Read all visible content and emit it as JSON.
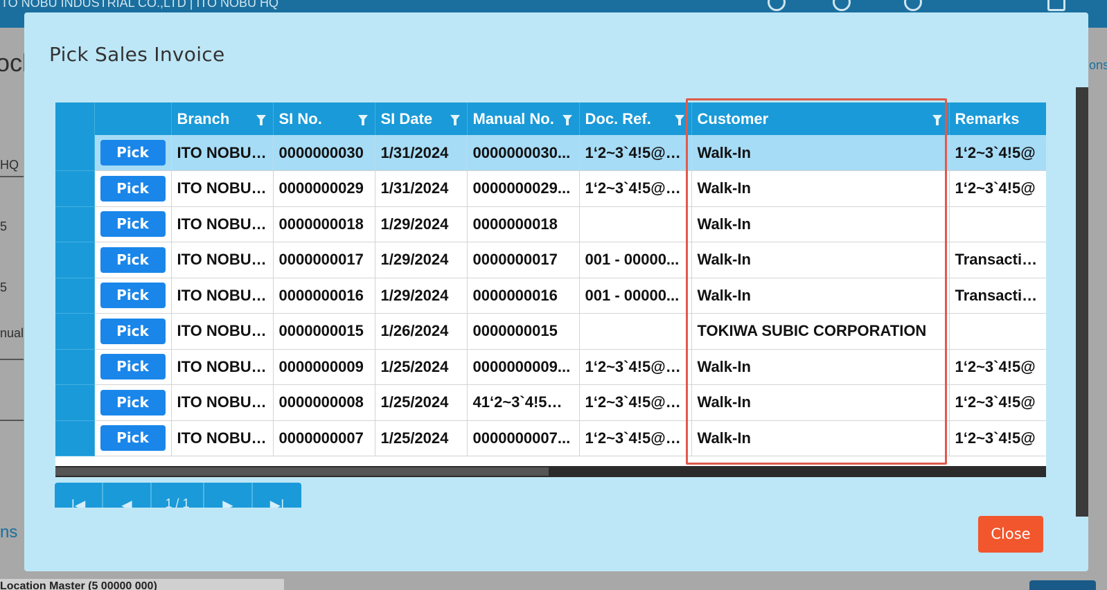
{
  "background": {
    "company": "ITO NOBU INDUSTRIAL CO.,LTD | ITO NOBU HQ",
    "texts": [
      "ock",
      "HQ",
      "5",
      "5",
      "nual",
      "ns",
      "ons"
    ],
    "bottom_text": "Location Master (5 00000 000)"
  },
  "modal": {
    "title": "Pick Sales Invoice",
    "close_label": "Close"
  },
  "grid": {
    "columns": [
      "",
      "",
      "Branch",
      "SI No.",
      "SI Date",
      "Manual No.",
      "Doc. Ref.",
      "Customer",
      "Remarks"
    ],
    "pick_label": "Pick",
    "rows": [
      {
        "branch": "ITO NOBU ...",
        "si_no": "0000000030",
        "si_date": "1/31/2024",
        "manual_no": "0000000030...",
        "doc_ref": "1‘2~3`4!5@6...",
        "customer": "Walk-In",
        "remarks": "1‘2~3`4!5@"
      },
      {
        "branch": "ITO NOBU ...",
        "si_no": "0000000029",
        "si_date": "1/31/2024",
        "manual_no": "0000000029...",
        "doc_ref": "1‘2~3`4!5@6...",
        "customer": "Walk-In",
        "remarks": "1‘2~3`4!5@"
      },
      {
        "branch": "ITO NOBU ...",
        "si_no": "0000000018",
        "si_date": "1/29/2024",
        "manual_no": "0000000018",
        "doc_ref": "",
        "customer": "Walk-In",
        "remarks": ""
      },
      {
        "branch": "ITO NOBU ...",
        "si_no": "0000000017",
        "si_date": "1/29/2024",
        "manual_no": "0000000017",
        "doc_ref": "001 - 00000...",
        "customer": "Walk-In",
        "remarks": "Transaction"
      },
      {
        "branch": "ITO NOBU ...",
        "si_no": "0000000016",
        "si_date": "1/29/2024",
        "manual_no": "0000000016",
        "doc_ref": "001 - 00000...",
        "customer": "Walk-In",
        "remarks": "Transaction"
      },
      {
        "branch": "ITO NOBU ...",
        "si_no": "0000000015",
        "si_date": "1/26/2024",
        "manual_no": "0000000015",
        "doc_ref": "",
        "customer": "TOKIWA SUBIC CORPORATION",
        "remarks": ""
      },
      {
        "branch": "ITO NOBU ...",
        "si_no": "0000000009",
        "si_date": "1/25/2024",
        "manual_no": "0000000009...",
        "doc_ref": "1‘2~3`4!5@6...",
        "customer": "Walk-In",
        "remarks": "1‘2~3`4!5@"
      },
      {
        "branch": "ITO NOBU ...",
        "si_no": "0000000008",
        "si_date": "1/25/2024",
        "manual_no": "41‘2~3`4!5@...",
        "doc_ref": "1‘2~3`4!5@6...",
        "customer": "Walk-In",
        "remarks": "1‘2~3`4!5@"
      },
      {
        "branch": "ITO NOBU ...",
        "si_no": "0000000007",
        "si_date": "1/25/2024",
        "manual_no": "0000000007...",
        "doc_ref": "1‘2~3`4!5@6...",
        "customer": "Walk-In",
        "remarks": "1‘2~3`4!5@"
      }
    ]
  },
  "pager": {
    "first": "|◀",
    "prev": "◀",
    "page_label": "1 / 1",
    "next": "▶",
    "last": "▶|"
  },
  "colors": {
    "header_blue": "#1a9ad8",
    "pick_button": "#1a86ea",
    "close_button": "#f2562d",
    "highlight": "#e05a4c",
    "modal_bg": "#bde7f7"
  }
}
